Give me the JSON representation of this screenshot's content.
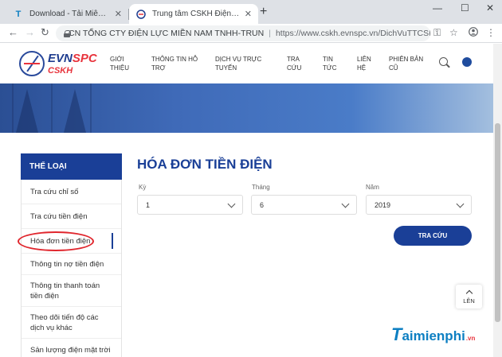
{
  "browser": {
    "tabs": [
      {
        "title": "Download - Tải Miễn Phí VN - P",
        "favicon": "T"
      },
      {
        "title": "Trung tâm CSKH Điện lực miền N",
        "favicon": "evn-logo"
      }
    ],
    "new_tab": "+",
    "window_controls": [
      "—",
      "☐",
      "✕"
    ],
    "back": "←",
    "forward": "→",
    "reload": "↻",
    "org_name": "CN TỔNG CTY ĐIỆN LỰC MIỀN NAM TNHH-TRUN",
    "separator": "|",
    "url": "https://www.cskh.evnspc.vn/DichVuTTCSKH/IndexSPC?...",
    "icons": [
      "key-icon",
      "star-icon",
      "account-icon",
      "menu-icon"
    ]
  },
  "site": {
    "logo": {
      "brand_evn": "EVN",
      "brand_spc": "SPC",
      "sub": "CSKH"
    },
    "nav": [
      {
        "line1": "Giới",
        "line2": "thiệu"
      },
      {
        "line1": "Thông tin hỗ",
        "line2": "trợ"
      },
      {
        "line1": "Dịch vụ trực",
        "line2": "tuyến"
      },
      {
        "line1": "Tra",
        "line2": "cứu"
      },
      {
        "line1": "Tin",
        "line2": "tức"
      },
      {
        "line1": "Liên",
        "line2": "hệ"
      },
      {
        "line1": "Phiên bản",
        "line2": "cũ"
      }
    ]
  },
  "sidebar": {
    "heading": "Thể loại",
    "items": [
      {
        "label": "Tra cứu chỉ số"
      },
      {
        "label": "Tra cứu tiền điện"
      },
      {
        "label": "Hóa đơn tiền điện"
      },
      {
        "label": "Thông tin nợ tiền điện"
      },
      {
        "label": "Thông tin thanh toán tiền điện"
      },
      {
        "label": "Theo dõi tiến độ các dịch vụ khác"
      },
      {
        "label": "Sản lượng điện mặt trời"
      }
    ],
    "active_index": 2
  },
  "main": {
    "title": "Hóa đơn tiền điện",
    "fields": [
      {
        "label": "Kỳ",
        "value": "1"
      },
      {
        "label": "Tháng",
        "value": "6"
      },
      {
        "label": "Năm",
        "value": "2019"
      }
    ],
    "submit_label": "Tra cứu",
    "scroll_top_label": "Lên"
  },
  "watermark": {
    "t": "T",
    "rest": "aimienphi",
    "vn": ".vn"
  },
  "colors": {
    "brand_blue": "#1a3f97",
    "brand_red": "#e8333c",
    "highlight_red": "#e0262d"
  }
}
